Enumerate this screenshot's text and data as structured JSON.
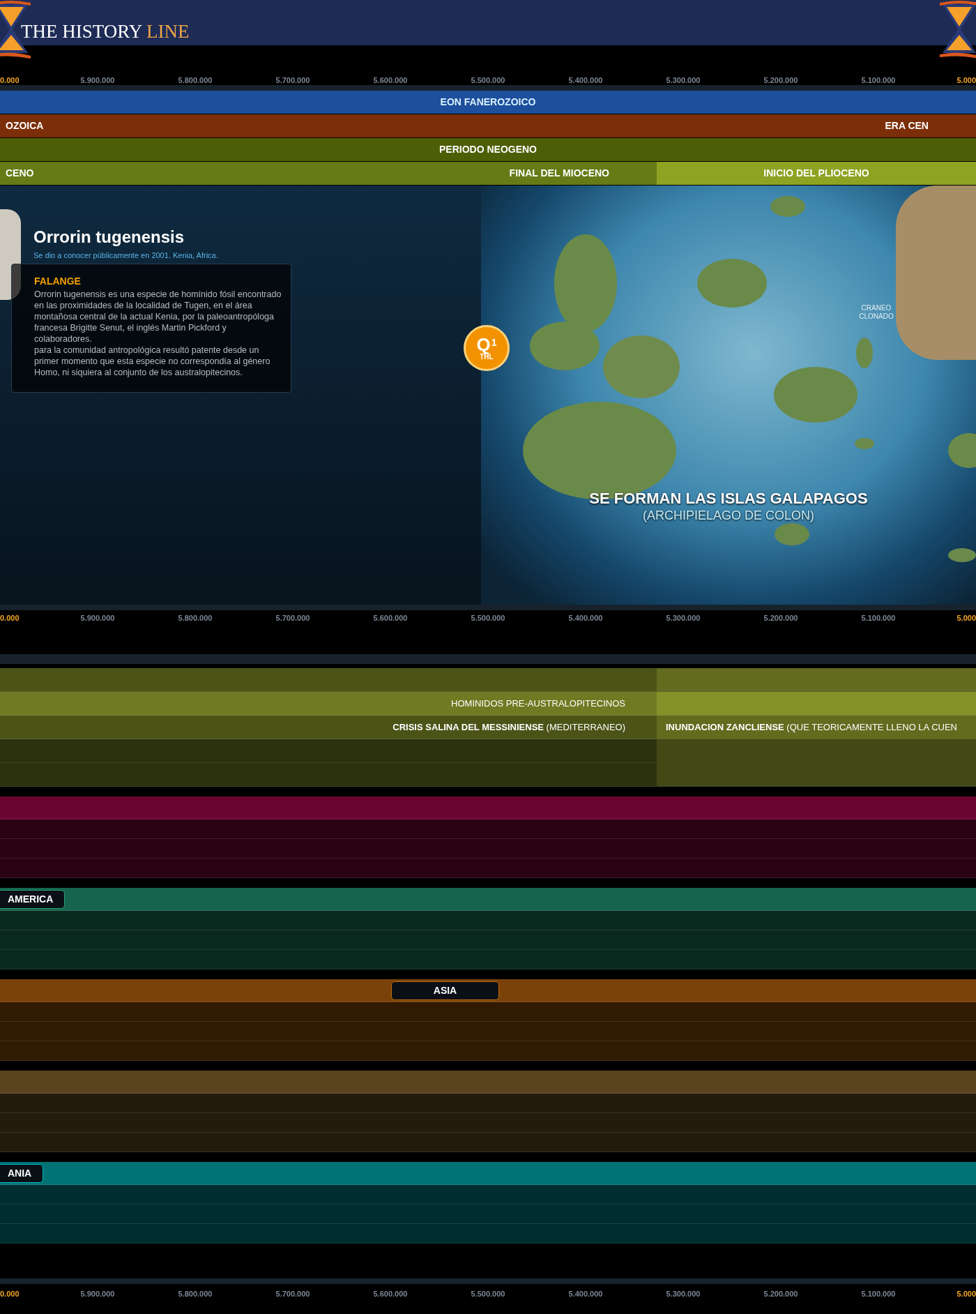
{
  "header": {
    "logo": {
      "text": "THE HISTORY ",
      "accent": "LINE"
    }
  },
  "axes": [
    {
      "ticks": [
        {
          "label": "0.000",
          "emphasis": true
        },
        {
          "label": "5.900.000",
          "emphasis": false
        },
        {
          "label": "5.800.000",
          "emphasis": false
        },
        {
          "label": "5.700.000",
          "emphasis": false
        },
        {
          "label": "5.600.000",
          "emphasis": false
        },
        {
          "label": "5.500.000",
          "emphasis": false
        },
        {
          "label": "5.400.000",
          "emphasis": false
        },
        {
          "label": "5.300.000",
          "emphasis": false
        },
        {
          "label": "5.200.000",
          "emphasis": false
        },
        {
          "label": "5.100.000",
          "emphasis": false
        },
        {
          "label": "5.000",
          "emphasis": true
        }
      ]
    },
    {
      "ticks": [
        {
          "label": "0.000",
          "emphasis": true
        },
        {
          "label": "5.900.000",
          "emphasis": false
        },
        {
          "label": "5.800.000",
          "emphasis": false
        },
        {
          "label": "5.700.000",
          "emphasis": false
        },
        {
          "label": "5.600.000",
          "emphasis": false
        },
        {
          "label": "5.500.000",
          "emphasis": false
        },
        {
          "label": "5.400.000",
          "emphasis": false
        },
        {
          "label": "5.300.000",
          "emphasis": false
        },
        {
          "label": "5.200.000",
          "emphasis": false
        },
        {
          "label": "5.100.000",
          "emphasis": false
        },
        {
          "label": "5.000",
          "emphasis": true
        }
      ]
    },
    {
      "ticks": [
        {
          "label": "0.000",
          "emphasis": true
        },
        {
          "label": "5.900.000",
          "emphasis": false
        },
        {
          "label": "5.800.000",
          "emphasis": false
        },
        {
          "label": "5.700.000",
          "emphasis": false
        },
        {
          "label": "5.600.000",
          "emphasis": false
        },
        {
          "label": "5.500.000",
          "emphasis": false
        },
        {
          "label": "5.400.000",
          "emphasis": false
        },
        {
          "label": "5.300.000",
          "emphasis": false
        },
        {
          "label": "5.200.000",
          "emphasis": false
        },
        {
          "label": "5.100.000",
          "emphasis": false
        },
        {
          "label": "5.000",
          "emphasis": true
        }
      ]
    }
  ],
  "periods": [
    {
      "kind": "eon",
      "segments": [
        {
          "selected": false,
          "texts": [
            {
              "label": "EON FANEROZOICO",
              "kind": "center"
            }
          ]
        }
      ]
    },
    {
      "kind": "era",
      "segments": [
        {
          "selected": false,
          "texts": [
            {
              "label": "OZOICA",
              "kind": "left"
            },
            {
              "label": "ERA CEN",
              "kind": "right"
            }
          ]
        }
      ]
    },
    {
      "kind": "period",
      "segments": [
        {
          "selected": false,
          "texts": [
            {
              "label": "PERIODO NEOGENO",
              "kind": "center"
            }
          ]
        }
      ]
    },
    {
      "kind": "epoch",
      "segments": [
        {
          "selected": false,
          "texts": [
            {
              "label": "CENO",
              "kind": "left"
            },
            {
              "label": "FINAL DEL MIOCENO",
              "kind": "right"
            }
          ]
        },
        {
          "selected": true,
          "texts": [
            {
              "label": "INICIO DEL PLIOCENO",
              "kind": "center"
            }
          ]
        }
      ]
    }
  ],
  "event": {
    "title": "Orrorin tugenensis",
    "subtitle": "Se dio a conocer públicamente en 2001. Kenia, Africa.",
    "card": {
      "heading": "FALANGE",
      "paragraphs": [
        "Orrorin tugenensis es una especie de homínido fósil encontrado en las proximidades de la localidad de Tugen, en el área montañosa central de la actual Kenia, por la paleoantropóloga francesa Brigitte Senut, el inglés Martin Pickford y colaboradores.",
        "para la comunidad antropológica resultó patente desde un primer momento que esta especie no correspondía al género Homo, ni siquiera al conjunto de los australopitecinos."
      ]
    },
    "badge": {
      "letter": "Q",
      "number": "1",
      "caption": "THL"
    },
    "headline": "SE FORMAN LAS ISLAS GALAPAGOS",
    "subheadline": "(ARCHIPIELAGO DE COLON)",
    "skull_caption": "CRANEO CLONADO"
  },
  "tracks": [
    {
      "color": "#6f7a22",
      "rows": [
        {
          "kind": "medium",
          "segments": [
            {
              "selected": false
            },
            {
              "selected": true
            }
          ]
        },
        {
          "kind": "strong",
          "segments": [
            {
              "selected": false,
              "text": "HOMINIDOS PRE-AUSTRALOPITECINOS",
              "kind": "right"
            },
            {
              "selected": true
            }
          ]
        },
        {
          "kind": "medium",
          "segments": [
            {
              "selected": false,
              "text": "**CRISIS SALINA DEL MESSINIENSE** (MEDITERRANEO)",
              "kind": "right"
            },
            {
              "selected": true,
              "text": "**INUNDACION ZANCLIENSE** (QUE TEORICAMENTE LLENO LA CUEN",
              "kind": "left"
            }
          ]
        },
        {
          "kind": "dim",
          "segments": [
            {
              "selected": false
            },
            {
              "selected": true
            }
          ]
        },
        {
          "kind": "dim",
          "segments": [
            {
              "selected": false
            },
            {
              "selected": true
            }
          ]
        }
      ]
    },
    {
      "color": "#6b0633",
      "rows": [
        {
          "kind": "strong"
        },
        {
          "kind": "dim"
        },
        {
          "kind": "dim"
        },
        {
          "kind": "dim"
        }
      ]
    },
    {
      "color": "#17644c",
      "label": {
        "text": "AMERICA",
        "kind": "left"
      },
      "rows": [
        {
          "kind": "strong"
        },
        {
          "kind": "dim"
        },
        {
          "kind": "dim"
        },
        {
          "kind": "dim"
        }
      ]
    },
    {
      "color": "#7a4208",
      "label": {
        "text": "ASIA",
        "kind": "center"
      },
      "rows": [
        {
          "kind": "strong"
        },
        {
          "kind": "dim"
        },
        {
          "kind": "dim"
        },
        {
          "kind": "dim"
        }
      ]
    },
    {
      "color": "#5a4420",
      "rows": [
        {
          "kind": "strong"
        },
        {
          "kind": "dim"
        },
        {
          "kind": "dim"
        },
        {
          "kind": "dim"
        }
      ]
    },
    {
      "color": "#007377",
      "label": {
        "text": "ANIA",
        "kind": "left"
      },
      "rows": [
        {
          "kind": "strong"
        },
        {
          "kind": "dim"
        },
        {
          "kind": "dim"
        },
        {
          "kind": "dim"
        }
      ]
    }
  ]
}
